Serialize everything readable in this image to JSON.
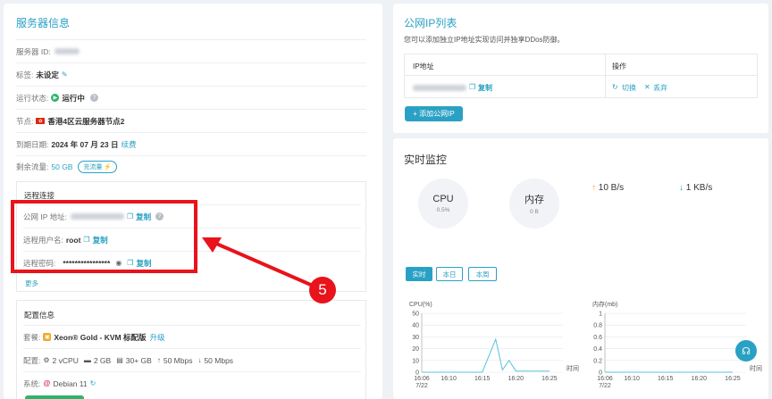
{
  "server_info": {
    "title": "服务器信息",
    "id_label": "服务器 ID:",
    "tag_label": "标签:",
    "tag_value": "未设定",
    "status_label": "运行状态:",
    "status_value": "运行中",
    "node_label": "节点:",
    "node_value": "香港4区云服务器节点2",
    "expiry_label": "到期日期:",
    "expiry_value": "2024 年 07 月 23 日",
    "renew_link": "续费",
    "traffic_label": "剩余流量:",
    "traffic_value": "50 GB",
    "recharge_button": "充流量"
  },
  "remote": {
    "section_title": "远程连接",
    "ip_label": "公网 IP 地址:",
    "copy_label": "复制",
    "user_label": "远程用户名:",
    "user_value": "root",
    "pwd_label": "远程密码:",
    "pwd_value": "****************",
    "more_link": "更多"
  },
  "config": {
    "section_title": "配置信息",
    "plan_label": "套餐:",
    "plan_value": "Xeon® Gold - KVM 标配版",
    "upgrade_link": "升级",
    "spec_label": "配置:",
    "cpu": "2 vCPU",
    "ram": "2 GB",
    "disk": "30+ GB",
    "up_bw": "50 Mbps",
    "down_bw": "50 Mbps",
    "os_label": "系统:",
    "os_value": "Debian 11"
  },
  "public_ip": {
    "title": "公网IP列表",
    "desc": "您可以添加独立IP地址实现访问并独享DDos防御。",
    "col_ip": "IP地址",
    "col_action": "操作",
    "copy_label": "复制",
    "switch_label": "切换",
    "discard_label": "丢弃",
    "add_button": "+ 添加公网IP"
  },
  "monitor": {
    "title": "实时监控",
    "cpu_title": "CPU",
    "cpu_value": "0.5%",
    "mem_title": "内存",
    "mem_value": "0 B",
    "upload": "10 B/s",
    "download": "1 KB/s",
    "tabs": [
      "实时",
      "本日",
      "本周"
    ]
  },
  "annotation": {
    "number": "5"
  },
  "colors": {
    "accent": "#2aa1c4",
    "annotation": "#e8131b",
    "running": "#2fb36b"
  },
  "chart_data": [
    {
      "type": "line",
      "title": "",
      "ylabel": "CPU(%)",
      "xlabel": "时间",
      "ylim": [
        0,
        50
      ],
      "yticks": [
        "50",
        "40",
        "30",
        "20",
        "10",
        "0"
      ],
      "xticks": [
        "16:06\n7/22",
        "16:10",
        "16:15",
        "16:20",
        "16:25"
      ],
      "x": [
        "16:06",
        "16:10",
        "16:15",
        "16:17",
        "16:18",
        "16:19",
        "16:20",
        "16:25"
      ],
      "series": [
        {
          "values": [
            0,
            0,
            0,
            28,
            2,
            10,
            1,
            1
          ]
        }
      ]
    },
    {
      "type": "line",
      "title": "",
      "ylabel": "内存(mb)",
      "xlabel": "时间",
      "ylim": [
        0,
        1
      ],
      "yticks": [
        "1",
        "0.8",
        "0.6",
        "0.4",
        "0.2",
        "0"
      ],
      "xticks": [
        "16:06\n7/22",
        "16:10",
        "16:15",
        "16:20",
        "16:25"
      ],
      "x": [
        "16:06",
        "16:25"
      ],
      "series": [
        {
          "values": [
            0,
            0
          ]
        }
      ]
    }
  ]
}
